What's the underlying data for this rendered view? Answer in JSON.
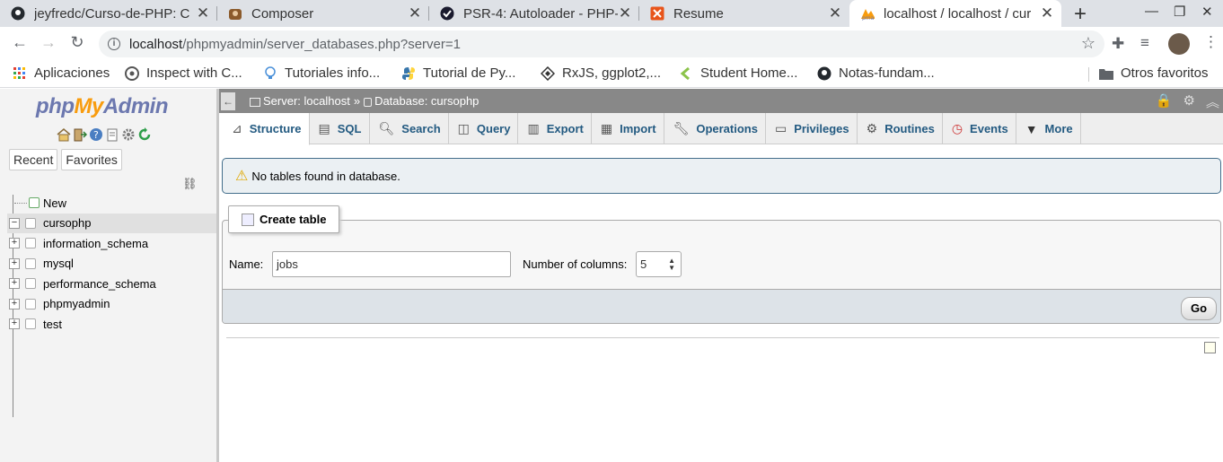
{
  "browser": {
    "tabs": [
      {
        "title": "jeyfredc/Curso-de-PHP: C",
        "icon": "github-icon",
        "active": false
      },
      {
        "title": "Composer",
        "icon": "composer-icon",
        "active": false
      },
      {
        "title": "PSR-4: Autoloader - PHP-",
        "icon": "psr-icon",
        "active": false
      },
      {
        "title": "Resume",
        "icon": "resume-icon",
        "active": false
      },
      {
        "title": "localhost / localhost / cur",
        "icon": "phpmyadmin-icon",
        "active": true
      }
    ],
    "url_host": "localhost",
    "url_path": "/phpmyadmin/server_databases.php?server=1",
    "bookmarks": [
      {
        "label": "Aplicaciones",
        "icon": "apps-grid-icon"
      },
      {
        "label": "Inspect with C...",
        "icon": "globe-icon"
      },
      {
        "label": "Tutoriales info...",
        "icon": "bulb-icon"
      },
      {
        "label": "Tutorial de Py...",
        "icon": "python-icon"
      },
      {
        "label": "RxJS, ggplot2,...",
        "icon": "diamond-icon"
      },
      {
        "label": "Student Home...",
        "icon": "chevron-green-icon"
      },
      {
        "label": "Notas-fundam...",
        "icon": "github-icon"
      }
    ],
    "other_bookmarks": "Otros favoritos"
  },
  "sidebar": {
    "logo_php": "php",
    "logo_my": "My",
    "logo_admin": "Admin",
    "tabs": [
      "Recent",
      "Favorites"
    ],
    "tree": [
      {
        "label": "New",
        "type": "new"
      },
      {
        "label": "cursophp",
        "type": "db",
        "expanded": true,
        "selected": true
      },
      {
        "label": "information_schema",
        "type": "db"
      },
      {
        "label": "mysql",
        "type": "db"
      },
      {
        "label": "performance_schema",
        "type": "db"
      },
      {
        "label": "phpmyadmin",
        "type": "db"
      },
      {
        "label": "test",
        "type": "db"
      }
    ]
  },
  "breadcrumb": {
    "server": "Server: localhost",
    "separator": "»",
    "database": "Database: cursophp"
  },
  "main_tabs": [
    {
      "label": "Structure",
      "icon": "structure-icon",
      "active": true
    },
    {
      "label": "SQL",
      "icon": "sql-icon"
    },
    {
      "label": "Search",
      "icon": "search-icon"
    },
    {
      "label": "Query",
      "icon": "query-icon"
    },
    {
      "label": "Export",
      "icon": "export-icon"
    },
    {
      "label": "Import",
      "icon": "import-icon"
    },
    {
      "label": "Operations",
      "icon": "wrench-icon"
    },
    {
      "label": "Privileges",
      "icon": "privileges-icon"
    },
    {
      "label": "Routines",
      "icon": "routines-icon"
    },
    {
      "label": "Events",
      "icon": "events-icon"
    },
    {
      "label": "More",
      "icon": "caret-down-icon"
    }
  ],
  "notice": "No tables found in database.",
  "create_table": {
    "legend": "Create table",
    "name_label": "Name:",
    "name_value": "jobs",
    "columns_label": "Number of columns:",
    "columns_value": "5",
    "go_label": "Go"
  },
  "colors": {
    "link_blue": "#235a81",
    "notice_bg": "#ebf0f3",
    "crumb_bg": "#888888",
    "logo_blue": "#6c78af",
    "logo_orange": "#f89c0e"
  }
}
